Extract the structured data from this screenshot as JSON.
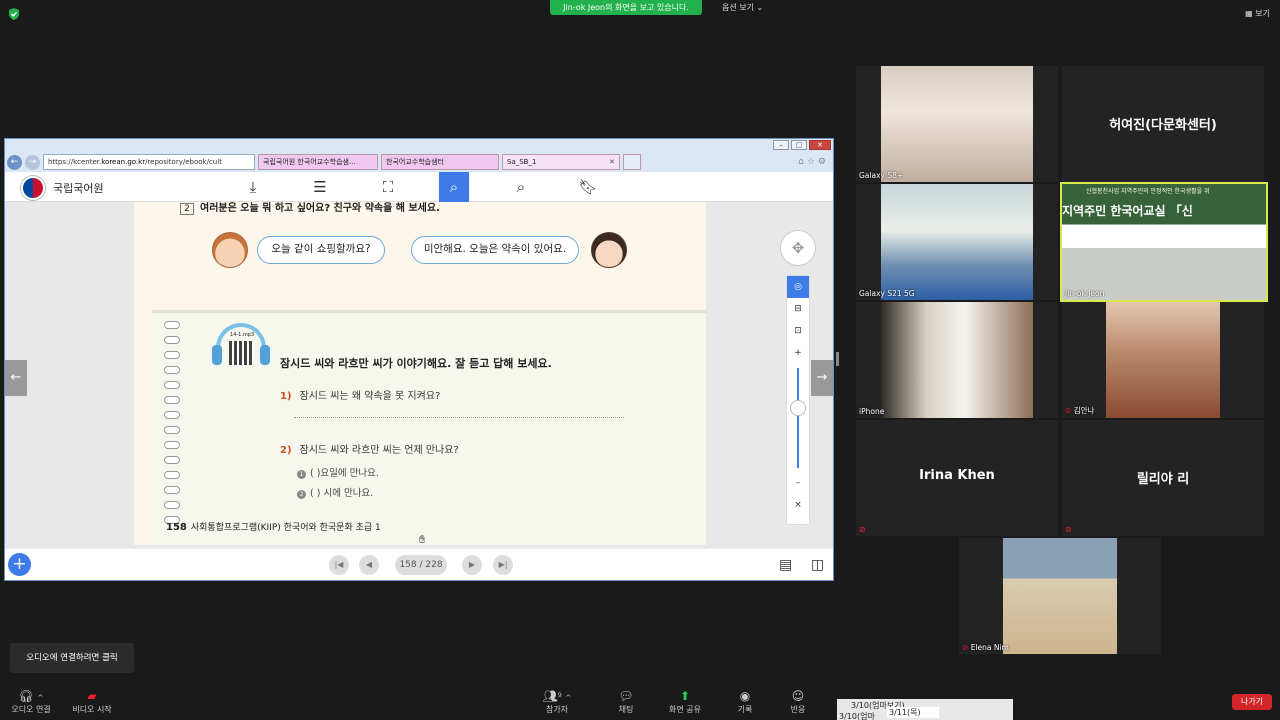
{
  "meeting": {
    "banner": "Jin-ok Jeon의 화면을 보고 있습니다.",
    "view_options": "옵션 보기 ⌄",
    "view_toggle": "보기"
  },
  "browser": {
    "url_prefix": "https://kcenter.",
    "url_host": "korean.go.kr",
    "url_rest": "/repository/ebook/cult",
    "tabs": [
      {
        "label": "국립국어원 한국어교수학습샘..."
      },
      {
        "label": "한국어교수학습샘터"
      },
      {
        "label": "Sa_SB_1"
      }
    ]
  },
  "ebook": {
    "logo_text": "국립국어원",
    "top_question_num": "2",
    "top_question": "여러분은 오늘 뭐 하고 싶어요? 친구와 약속을 해 보세요.",
    "bubble_left": "오늘 같이 쇼핑할까요?",
    "bubble_right": "미안해요. 오늘은 약속이 있어요.",
    "audio_track": "14-1.mp3",
    "main_question": "잠시드 씨와 라흐만 씨가 이야기해요. 잘 듣고 답해 보세요.",
    "sub1_num": "1)",
    "sub1": "잠시드 씨는 왜 약속을 못 지켜요?",
    "sub2_num": "2)",
    "sub2": "잠시드 씨와 라흐만 씨는 언제 만나요?",
    "opt1_mark": "1",
    "opt1": "(            )요일에 만나요.",
    "opt2_mark": "2",
    "opt2": "(            ) 시에 만나요.",
    "page_number": "158",
    "page_footer": "사회통합프로그램(KIIP) 한국어와 한국문화 초급 1",
    "page_indicator": "158 / 228"
  },
  "participants": [
    {
      "name": "Galaxy S8+",
      "video": true,
      "muted": false
    },
    {
      "name": "허여진(다문화센터)",
      "video": false,
      "muted": false
    },
    {
      "name": "Galaxy S21 5G",
      "video": true,
      "muted": false
    },
    {
      "name": "Jin-ok Jeon",
      "video": true,
      "muted": false,
      "speaking": true,
      "banner_small": "신협봉천사업  지역주민의 안정적인 한국생활을 위",
      "banner_big": "지역주민 한국어교실 「신"
    },
    {
      "name": "iPhone",
      "video": true,
      "muted": false
    },
    {
      "name": "김안나",
      "video": true,
      "muted": true
    },
    {
      "name": "Irina Khen",
      "video": false,
      "muted": true
    },
    {
      "name": "릴리야 리",
      "video": false,
      "muted": true
    },
    {
      "name": "Elena Nim",
      "video": true,
      "muted": true
    }
  ],
  "toolbar": {
    "tooltip": "오디오에 연결하려면 클릭",
    "audio": "오디오 연결",
    "video": "비디오 시작",
    "participants": "참가자",
    "participant_count": "9",
    "chat": "채팅",
    "share": "화면 공유",
    "record": "기록",
    "reactions": "반응",
    "leave": "나가기"
  },
  "taskbar": {
    "item1": "3/10(엄마보기)",
    "item2": "3/11(목)",
    "item3": "3/10(엄마"
  },
  "colors": {
    "accent": "#3d7be6",
    "share_green": "#22b14c",
    "leave_red": "#d3242a",
    "speaking_border": "#d9e84a"
  }
}
